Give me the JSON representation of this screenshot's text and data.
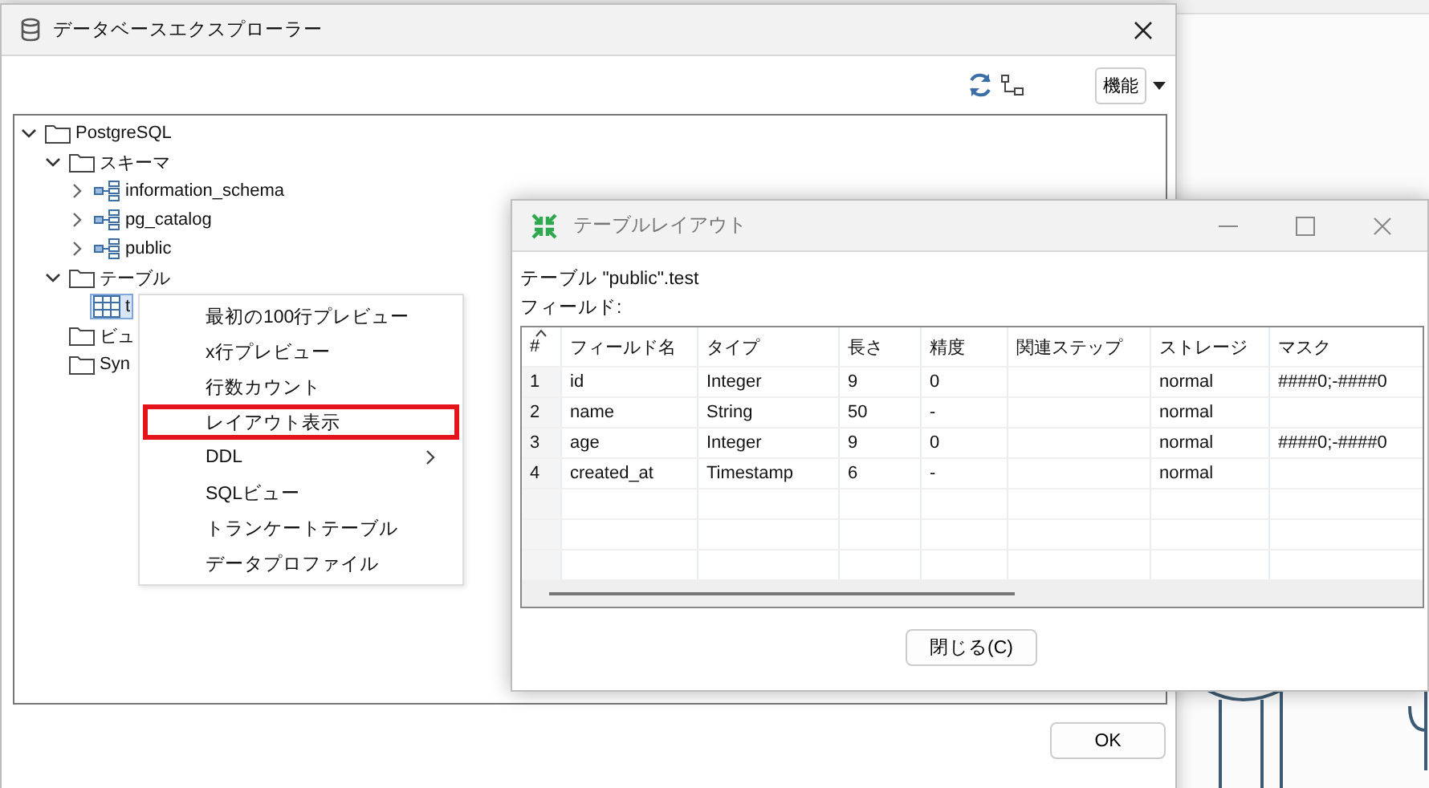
{
  "main_window": {
    "title": "データベースエクスプローラー",
    "function_button": "機能",
    "ok_button": "OK",
    "tree": [
      {
        "label": "PostgreSQL",
        "kind": "folder",
        "expanded": true,
        "selected": false,
        "children": [
          {
            "label": "スキーマ",
            "kind": "folder",
            "expanded": true,
            "selected": false,
            "children": [
              {
                "label": "information_schema",
                "kind": "schema",
                "expanded": false,
                "selected": false
              },
              {
                "label": "pg_catalog",
                "kind": "schema",
                "expanded": false,
                "selected": false
              },
              {
                "label": "public",
                "kind": "schema",
                "expanded": false,
                "selected": false
              }
            ]
          },
          {
            "label": "テーブル",
            "kind": "folder",
            "expanded": true,
            "selected": false,
            "children": [
              {
                "label": "t",
                "kind": "table",
                "selected": true
              }
            ]
          },
          {
            "label": "ビュ",
            "kind": "folder",
            "selected": false
          },
          {
            "label": "Syn",
            "kind": "folder",
            "selected": false
          }
        ]
      }
    ]
  },
  "context_menu": {
    "items": [
      {
        "label": "最初の100行プレビュー",
        "has_submenu": false,
        "highlighted": false
      },
      {
        "label": "x行プレビュー",
        "has_submenu": false,
        "highlighted": false
      },
      {
        "label": "行数カウント",
        "has_submenu": false,
        "highlighted": false
      },
      {
        "label": "レイアウト表示",
        "has_submenu": false,
        "highlighted": true
      },
      {
        "label": "DDL",
        "has_submenu": true,
        "highlighted": false
      },
      {
        "label": "SQLビュー",
        "has_submenu": false,
        "highlighted": false
      },
      {
        "label": "トランケートテーブル",
        "has_submenu": false,
        "highlighted": false
      },
      {
        "label": "データプロファイル",
        "has_submenu": false,
        "highlighted": false
      }
    ]
  },
  "layout_dialog": {
    "title": "テーブルレイアウト",
    "table_label": "テーブル  \"public\".test",
    "fields_label": "フィールド:",
    "close_button": "閉じる(C)",
    "columns": [
      "#",
      "フィールド名",
      "タイプ",
      "長さ",
      "精度",
      "関連ステップ",
      "ストレージ",
      "マスク"
    ],
    "rows": [
      {
        "no": "1",
        "name": "id",
        "type": "Integer",
        "length": "9",
        "precision": "0",
        "storage": "normal",
        "mask": "####0;-####0"
      },
      {
        "no": "2",
        "name": "name",
        "type": "String",
        "length": "50",
        "precision": "-",
        "storage": "normal"
      },
      {
        "no": "3",
        "name": "age",
        "type": "Integer",
        "length": "9",
        "precision": "0",
        "storage": "normal",
        "mask": "####0;-####0"
      },
      {
        "no": "4",
        "name": "created_at",
        "type": "Timestamp",
        "length": "6",
        "precision": "-",
        "storage": "normal"
      }
    ]
  }
}
